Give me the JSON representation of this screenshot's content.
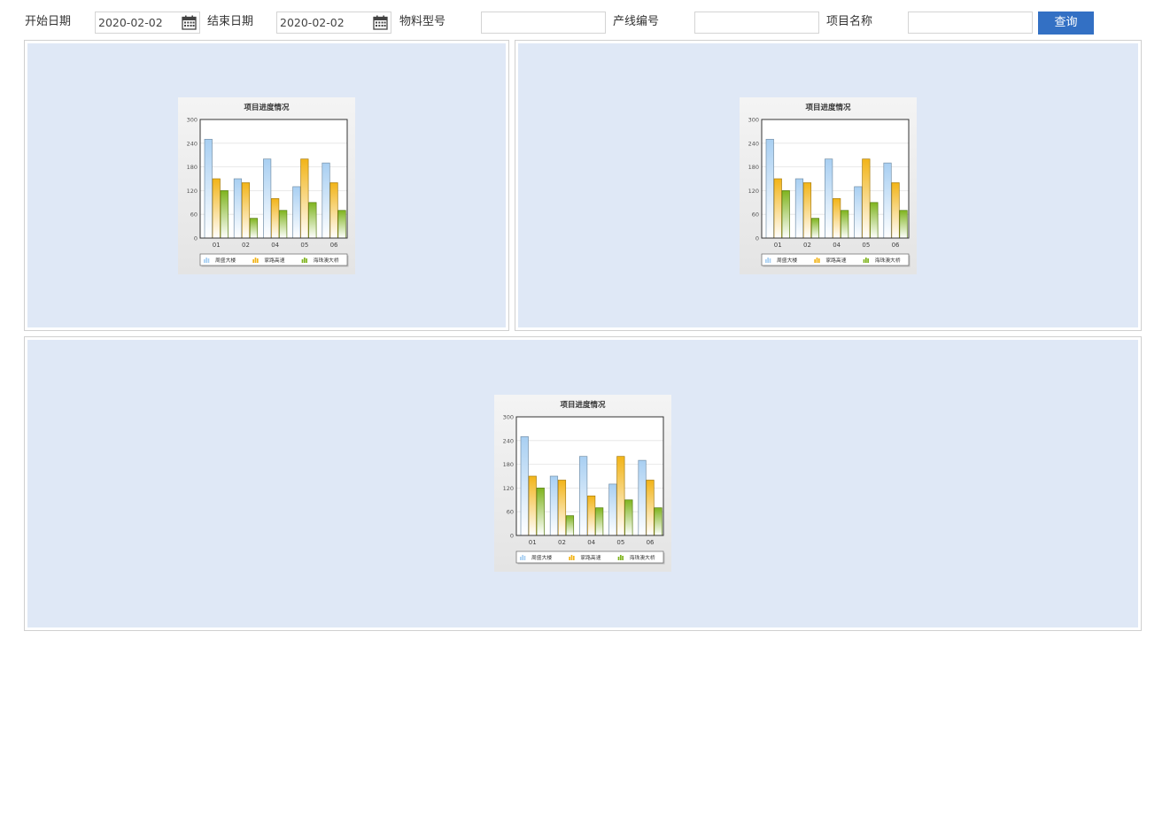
{
  "filters": {
    "start_date_label": "开始日期",
    "start_date_value": "2020-02-02",
    "end_date_label": "结束日期",
    "end_date_value": "2020-02-02",
    "material_label": "物料型号",
    "material_value": "",
    "line_label": "产线编号",
    "line_value": "",
    "project_label": "项目名称",
    "project_value": "",
    "query_button": "查询"
  },
  "icons": {
    "date_picker": "calendar-icon",
    "legend_marker": "bar-chart-icon"
  },
  "colors": {
    "button": "#3370c4",
    "panel_bg": "#dfe8f6"
  },
  "chart_data": [
    {
      "type": "bar",
      "title": "项目进度情况",
      "categories": [
        "01",
        "02",
        "04",
        "05",
        "06"
      ],
      "series": [
        {
          "name": "周盛大楼",
          "values": [
            250,
            150,
            200,
            130,
            190
          ],
          "color": "#a8cff2"
        },
        {
          "name": "家路高速",
          "values": [
            150,
            140,
            100,
            200,
            140
          ],
          "color": "#f2b418"
        },
        {
          "name": "海珠澳大桥",
          "values": [
            120,
            50,
            70,
            90,
            70
          ],
          "color": "#7fb41e"
        }
      ],
      "ylim": [
        0,
        300
      ],
      "yticks": [
        0,
        60,
        120,
        180,
        240,
        300
      ],
      "legend": "bottom",
      "grid": true
    },
    {
      "type": "bar",
      "title": "项目进度情况",
      "categories": [
        "01",
        "02",
        "04",
        "05",
        "06"
      ],
      "series": [
        {
          "name": "周盛大楼",
          "values": [
            250,
            150,
            200,
            130,
            190
          ],
          "color": "#a8cff2"
        },
        {
          "name": "家路高速",
          "values": [
            150,
            140,
            100,
            200,
            140
          ],
          "color": "#f2b418"
        },
        {
          "name": "海珠澳大桥",
          "values": [
            120,
            50,
            70,
            90,
            70
          ],
          "color": "#7fb41e"
        }
      ],
      "ylim": [
        0,
        300
      ],
      "yticks": [
        0,
        60,
        120,
        180,
        240,
        300
      ],
      "legend": "bottom",
      "grid": true
    },
    {
      "type": "bar",
      "title": "项目进度情况",
      "categories": [
        "01",
        "02",
        "04",
        "05",
        "06"
      ],
      "series": [
        {
          "name": "周盛大楼",
          "values": [
            250,
            150,
            200,
            130,
            190
          ],
          "color": "#a8cff2"
        },
        {
          "name": "家路高速",
          "values": [
            150,
            140,
            100,
            200,
            140
          ],
          "color": "#f2b418"
        },
        {
          "name": "海珠澳大桥",
          "values": [
            120,
            50,
            70,
            90,
            70
          ],
          "color": "#7fb41e"
        }
      ],
      "ylim": [
        0,
        300
      ],
      "yticks": [
        0,
        60,
        120,
        180,
        240,
        300
      ],
      "legend": "bottom",
      "grid": true
    }
  ]
}
